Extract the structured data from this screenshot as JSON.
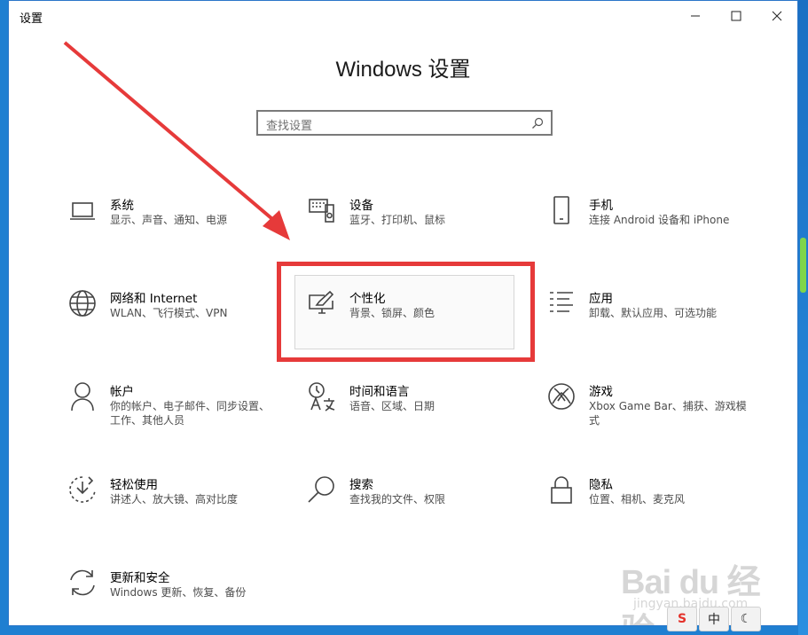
{
  "window": {
    "title": "设置"
  },
  "controls": {
    "minimize": "—",
    "maximize": "☐",
    "close": "✕"
  },
  "heading": "Windows 设置",
  "search": {
    "placeholder": "查找设置"
  },
  "tiles": [
    {
      "title": "系统",
      "desc": "显示、声音、通知、电源",
      "icon": "laptop-icon"
    },
    {
      "title": "设备",
      "desc": "蓝牙、打印机、鼠标",
      "icon": "devices-icon"
    },
    {
      "title": "手机",
      "desc": "连接 Android 设备和 iPhone",
      "icon": "phone-icon"
    },
    {
      "title": "网络和 Internet",
      "desc": "WLAN、飞行模式、VPN",
      "icon": "globe-icon"
    },
    {
      "title": "个性化",
      "desc": "背景、锁屏、颜色",
      "icon": "personalization-icon"
    },
    {
      "title": "应用",
      "desc": "卸载、默认应用、可选功能",
      "icon": "apps-list-icon"
    },
    {
      "title": "帐户",
      "desc": "你的帐户、电子邮件、同步设置、工作、其他人员",
      "icon": "person-icon"
    },
    {
      "title": "时间和语言",
      "desc": "语音、区域、日期",
      "icon": "time-language-icon"
    },
    {
      "title": "游戏",
      "desc": "Xbox Game Bar、捕获、游戏模式",
      "icon": "xbox-icon"
    },
    {
      "title": "轻松使用",
      "desc": "讲述人、放大镜、高对比度",
      "icon": "ease-of-access-icon"
    },
    {
      "title": "搜索",
      "desc": "查找我的文件、权限",
      "icon": "search-magnifier-icon"
    },
    {
      "title": "隐私",
      "desc": "位置、相机、麦克风",
      "icon": "lock-icon"
    },
    {
      "title": "更新和安全",
      "desc": "Windows 更新、恢复、备份",
      "icon": "sync-icon"
    }
  ],
  "watermark": {
    "logo": "Bai du 经验",
    "url": "jingyan.baidu.com"
  },
  "ime": {
    "sogou": "S",
    "lang": "中",
    "moon": "☾"
  },
  "colors": {
    "annotation_red": "#e63a3a",
    "desktop_blue": "#1f7fd1"
  }
}
